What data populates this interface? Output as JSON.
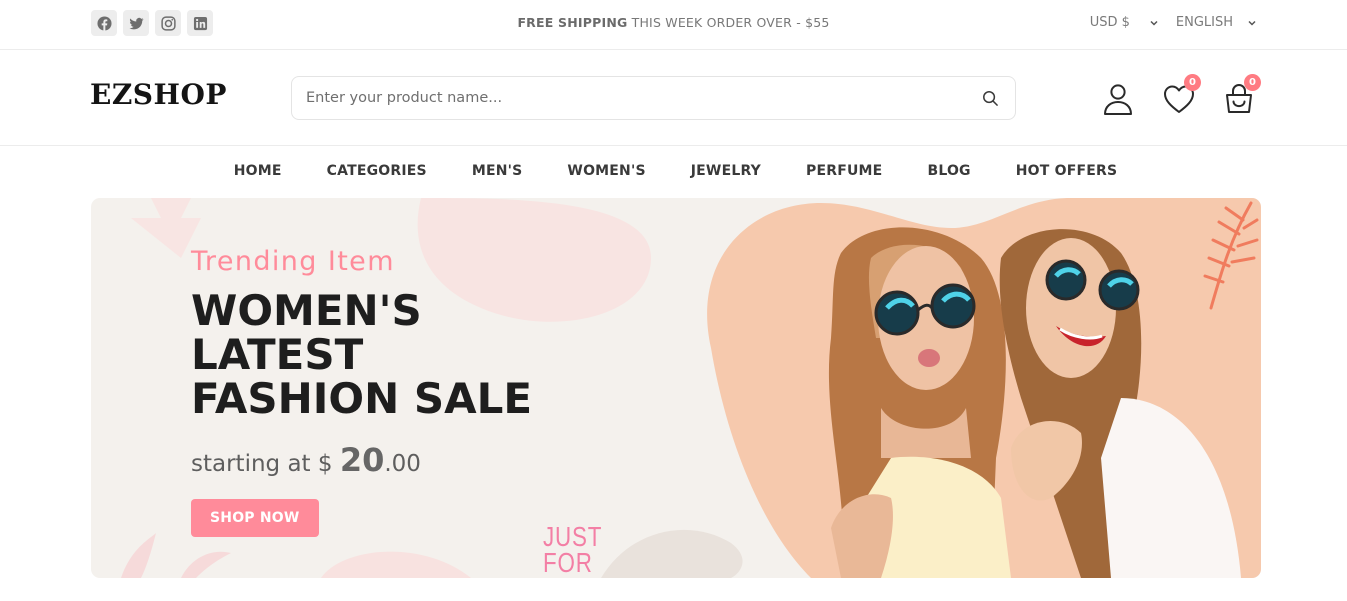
{
  "topbar": {
    "social": [
      {
        "name": "facebook-icon"
      },
      {
        "name": "twitter-icon"
      },
      {
        "name": "instagram-icon"
      },
      {
        "name": "linkedin-icon"
      }
    ],
    "promo_bold": "FREE SHIPPING",
    "promo_rest": " THIS WEEK ORDER OVER - $55",
    "currency": "USD $",
    "language": "ENGLISH"
  },
  "header": {
    "logo": "EZSHOP",
    "search_placeholder": "Enter your product name...",
    "wishlist_count": "0",
    "cart_count": "0"
  },
  "nav": {
    "items": [
      "HOME",
      "CATEGORIES",
      "MEN'S",
      "WOMEN'S",
      "JEWELRY",
      "PERFUME",
      "BLOG",
      "HOT OFFERS"
    ]
  },
  "hero": {
    "eyebrow": "Trending Item",
    "title_line1": "WOMEN'S",
    "title_line2": "LATEST",
    "title_line3": "FASHION SALE",
    "price_prefix": "starting at $ ",
    "price_whole": "20",
    "price_cents": ".00",
    "cta": "SHOP NOW",
    "deco_line1": "JUST",
    "deco_line2": "FOR"
  },
  "colors": {
    "accent": "#ff8b9a",
    "badge": "#ff7b82",
    "hero_bg": "#f4f1ed",
    "photo_bg": "#f6c9ad"
  }
}
